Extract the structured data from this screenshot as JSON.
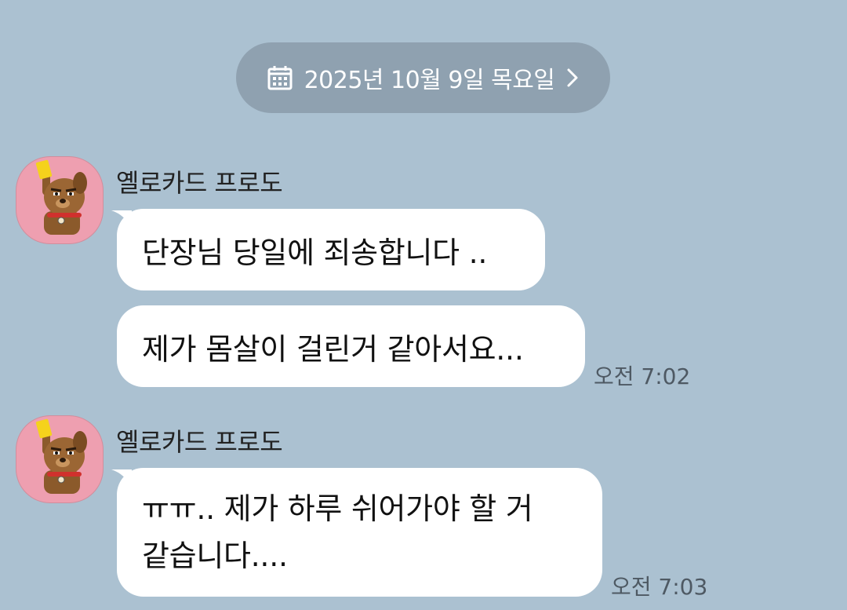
{
  "date_divider": {
    "label": "2025년 10월 9일 목요일",
    "icon": "calendar-icon",
    "chevron": "chevron-right-icon"
  },
  "groups": [
    {
      "sender": "옐로카드 프로도",
      "avatar": "yellow-card-dog-avatar",
      "messages": [
        {
          "text": "단장님 당일에 죄송합니다 .."
        },
        {
          "text": "제가 몸살이 걸린거 같아서요..."
        }
      ],
      "time": "오전 7:02"
    },
    {
      "sender": "옐로카드 프로도",
      "avatar": "yellow-card-dog-avatar",
      "messages": [
        {
          "line1": "ㅠㅠ.. 제가 하루 쉬어가야 할 거",
          "line2": "같습니다...."
        }
      ],
      "time": "오전 7:03"
    }
  ],
  "colors": {
    "background": "#abc1d1",
    "date_pill": "#8fa1b0",
    "bubble": "#ffffff",
    "avatar_bg": "#ee9fb0"
  }
}
